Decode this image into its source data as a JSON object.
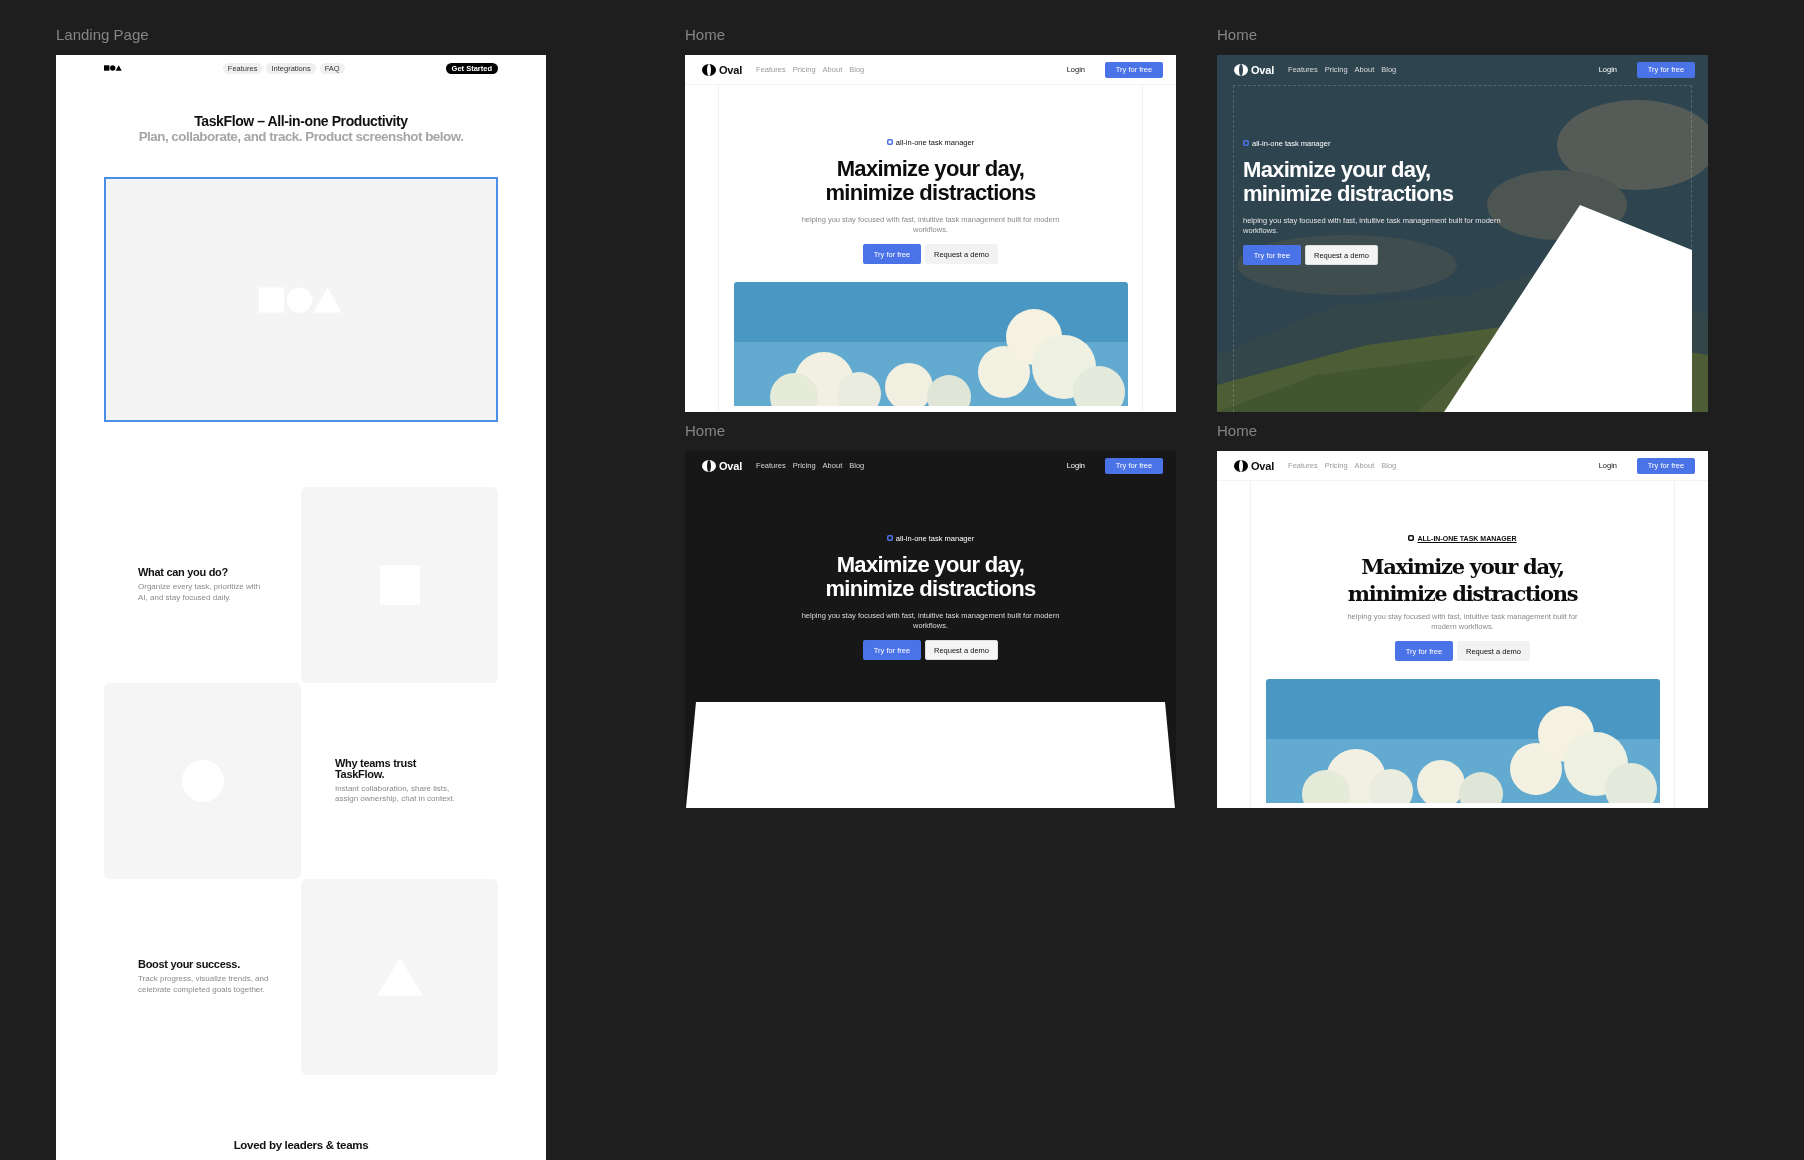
{
  "landing": {
    "label": "Landing Page",
    "nav": {
      "links": [
        "Features",
        "Integrations",
        "FAQ"
      ],
      "cta": "Get Started"
    },
    "hero": {
      "title": "TaskFlow – All-in-one Productivity",
      "subtitle": "Plan, collaborate, and track. Product screenshot below."
    },
    "screenshot_placeholder": {
      "selected": true
    },
    "features": [
      {
        "title": "What can you do?",
        "body": "Organize every task, prioritize with AI, and stay focused daily.",
        "kind": "square"
      },
      {
        "title": "Why teams trust TaskFlow.",
        "body": "Instant collaboration, share lists, assign ownership, chat in context.",
        "kind": "circle"
      },
      {
        "title": "Boost your success.",
        "body": "Track progress, visualize trends, and celebrate completed goals together.",
        "kind": "triangle"
      }
    ],
    "testimonials": {
      "title": "Loved by leaders & teams"
    }
  },
  "home_frames": [
    {
      "label": "Home",
      "kind": "light",
      "left_aligned": false,
      "brand": "Oval",
      "nav_links": [
        "Features",
        "Pricing",
        "About",
        "Blog"
      ],
      "login": "Login",
      "nav_cta": "Try for free",
      "badge": "all-in-one task manager",
      "headline": "Maximize your day, minimize distractions",
      "subtitle": "helping you stay focused with fast, intuitive task management built for modern workflows.",
      "primary": "Try for free",
      "secondary": "Request a demo"
    },
    {
      "label": "Home",
      "left_aligned": true,
      "media": {
        "kind": "tilted"
      },
      "brand": "Oval",
      "nav_links": [
        "Features",
        "Pricing",
        "About",
        "Blog"
      ],
      "login": "Login",
      "nav_cta": "Try for free",
      "badge": "all-in-one task manager",
      "headline": "Maximize your day, minimize distractions",
      "subtitle": "helping you stay focused with fast, intuitive task management built for modern workflows.",
      "primary": "Try for free",
      "secondary": "Request a demo"
    },
    {
      "label": "Home",
      "kind": "dark",
      "left_aligned": false,
      "media": {
        "kind": "trapezoid"
      },
      "brand": "Oval",
      "nav_links": [
        "Features",
        "Pricing",
        "About",
        "Blog"
      ],
      "login": "Login",
      "nav_cta": "Try for free",
      "badge": "all-in-one task manager",
      "headline": "Maximize your day, minimize distractions",
      "subtitle": "helping you stay focused with fast, intuitive task management built for modern workflows.",
      "primary": "Try for free",
      "secondary": "Request a demo"
    },
    {
      "label": "Home",
      "kind": "editorial",
      "left_aligned": false,
      "brand": "Oval",
      "nav_links": [
        "Features",
        "Pricing",
        "About",
        "Blog"
      ],
      "login": "Login",
      "nav_cta": "Try for free",
      "badge": "ALL-IN-ONE TASK MANAGER",
      "headline": "Maximize your day, minimize distractions",
      "subtitle": "helping you stay focused with fast, intuitive task management built for modern workflows.",
      "primary": "Try for free",
      "secondary": "Request a demo"
    }
  ]
}
